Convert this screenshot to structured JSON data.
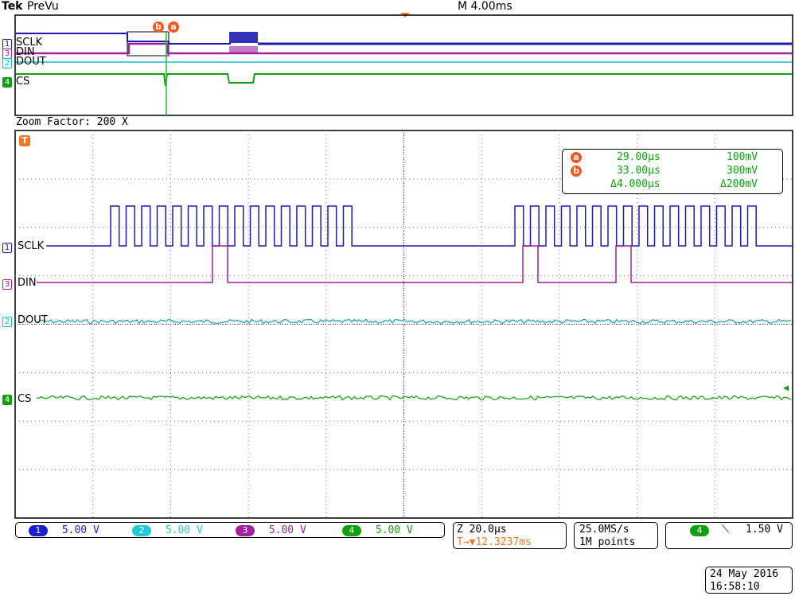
{
  "header": {
    "brand": "Tek",
    "mode": "PreVu",
    "timebase": "M 4.00ms"
  },
  "overview": {
    "channels": [
      {
        "num": "1",
        "label": "SCLK",
        "color": "#1c1cb4"
      },
      {
        "num": "3",
        "label": "DIN",
        "color": "#a020a0"
      },
      {
        "num": "2",
        "label": "DOUT",
        "color": "#10c0d0"
      },
      {
        "num": "4",
        "label": "CS",
        "color": "#10a010"
      }
    ],
    "cursor_b": "b",
    "cursor_a": "a"
  },
  "zoom": {
    "title": "Zoom Factor: 200 X",
    "trigger_icon": "T",
    "channels": [
      {
        "num": "1",
        "label": "SCLK",
        "color": "#1c1cb4"
      },
      {
        "num": "3",
        "label": "DIN",
        "color": "#a020a0"
      },
      {
        "num": "2",
        "label": "DOUT",
        "color": "#10a0b0"
      },
      {
        "num": "4",
        "label": "CS",
        "color": "#10a010"
      }
    ],
    "cursor_readout": {
      "a_label": "a",
      "a_time": "29.00µs",
      "a_volt": "100mV",
      "b_label": "b",
      "b_time": "33.00µs",
      "b_volt": "300mV",
      "delta_time": "Δ4.000µs",
      "delta_volt": "Δ200mV"
    }
  },
  "status": {
    "ch1": {
      "num": "1",
      "scale": "5.00 V",
      "color": "#1c1cd0"
    },
    "ch2": {
      "num": "2",
      "scale": "5.00 V",
      "color": "#20c8d8"
    },
    "ch3": {
      "num": "3",
      "scale": "5.00 V",
      "color": "#a020a0"
    },
    "ch4": {
      "num": "4",
      "scale": "5.00 V",
      "color": "#10a010"
    },
    "zoom_time": "Z 20.0µs",
    "trigger_pos": "T→▼12.3237ms",
    "sample_rate": "25.0MS/s",
    "record_length": "1M points",
    "trig_ch": "4",
    "trig_slope": "⟍",
    "trig_level": "1.50 V",
    "date": "24 May 2016",
    "time": "16:58:10"
  },
  "colors": {
    "orange": "#f07820",
    "grid": "#888888"
  }
}
